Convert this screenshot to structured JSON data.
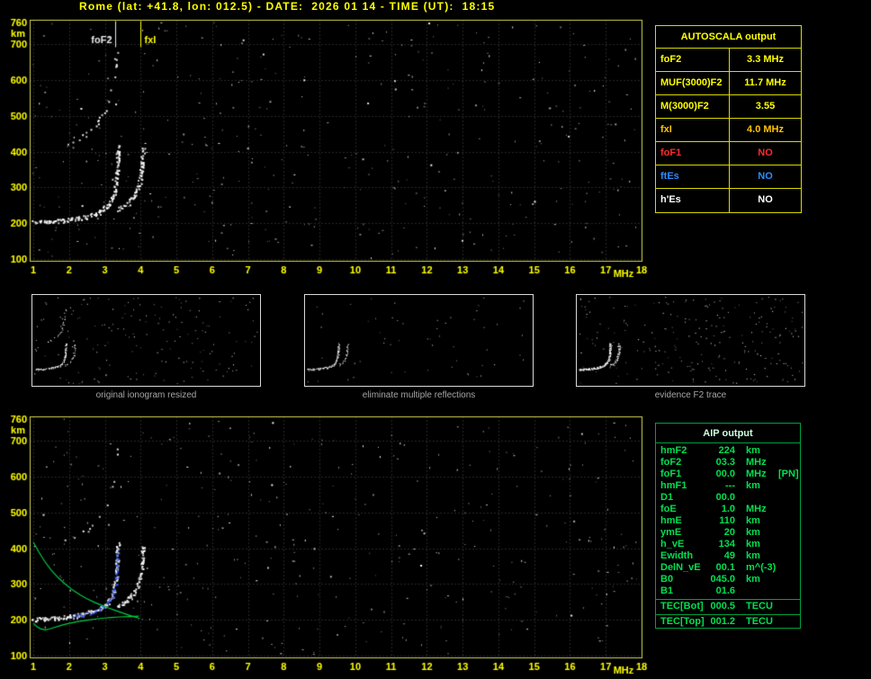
{
  "title": "Rome (lat: +41.8, lon: 012.5) - DATE:  2026 01 14 - TIME (UT):  18:15",
  "colors": {
    "background": "#000000",
    "title": "#ffff00",
    "axis_labels": "#ffff00",
    "grid": "#4f4f4f",
    "plot_border": "#d6d64e",
    "trace_white": "#ffffff",
    "autoscaled_trace_blue": "#2f55ee",
    "profile_green": "#00cc44",
    "autoscala_border": "#d8d800",
    "aip_border": "#00a040",
    "aip_text": "#00e050",
    "caption_gray": "#a6a6a6"
  },
  "autoscala_table": {
    "header": "AUTOSCALA output",
    "rows": [
      {
        "label": "foF2",
        "value": "3.3 MHz",
        "color": "#ffff00"
      },
      {
        "label": "MUF(3000)F2",
        "value": "11.7 MHz",
        "color": "#ffff00"
      },
      {
        "label": "M(3000)F2",
        "value": "3.55",
        "color": "#ffff00"
      },
      {
        "label": "fxI",
        "value": "4.0 MHz",
        "color": "#ffc400"
      },
      {
        "label": "foF1",
        "value": "NO",
        "color": "#ff2a2a"
      },
      {
        "label": "ftEs",
        "value": "NO",
        "color": "#2d8cff"
      },
      {
        "label": "h'Es",
        "value": "NO",
        "color": "#ffffff"
      }
    ]
  },
  "aip_table": {
    "header": "AIP output",
    "rows": [
      {
        "name": "hmF2",
        "value": "224",
        "unit": "km",
        "note": ""
      },
      {
        "name": "foF2",
        "value": "03.3",
        "unit": "MHz",
        "note": ""
      },
      {
        "name": "foF1",
        "value": "00.0",
        "unit": "MHz",
        "note": "[PN]"
      },
      {
        "name": "hmF1",
        "value": "---",
        "unit": "km",
        "note": ""
      },
      {
        "name": "D1",
        "value": "00.0",
        "unit": "",
        "note": ""
      },
      {
        "name": "foE",
        "value": "1.0",
        "unit": "MHz",
        "note": ""
      },
      {
        "name": "hmE",
        "value": "110",
        "unit": "km",
        "note": ""
      },
      {
        "name": "ymE",
        "value": "20",
        "unit": "km",
        "note": ""
      },
      {
        "name": "h_vE",
        "value": "134",
        "unit": "km",
        "note": ""
      },
      {
        "name": "Ewidth",
        "value": "49",
        "unit": "km",
        "note": ""
      },
      {
        "name": "DelN_vE",
        "value": "00.1",
        "unit": "m^(-3)",
        "note": ""
      },
      {
        "name": "B0",
        "value": "045.0",
        "unit": "km",
        "note": ""
      },
      {
        "name": "B1",
        "value": "01.6",
        "unit": "",
        "note": ""
      }
    ],
    "tec_rows": [
      {
        "name": "TEC[Bot]",
        "value": "000.5",
        "unit": "TECU",
        "note": ""
      },
      {
        "name": "TEC[Top]",
        "value": "001.2",
        "unit": "TECU",
        "note": ""
      }
    ]
  },
  "thumbnails": [
    {
      "caption": "original ionogram resized",
      "noise": {
        "seed": 901,
        "count": 175
      },
      "dot_traces": [
        {
          "ref": "f2_ordinary",
          "color": "#ffffff",
          "thick": 2,
          "prob": 0.9
        },
        {
          "ref": "f2_extraordinary",
          "color": "#ffffff",
          "thick": 1,
          "prob": 0.8
        },
        {
          "ref": "second_hop",
          "color": "#ffffff",
          "thick": 1,
          "prob": 0.5
        }
      ]
    },
    {
      "caption": "eliminate multiple reflections",
      "noise": {
        "seed": 902,
        "count": 55
      },
      "dot_traces": [
        {
          "ref": "f2_ordinary",
          "color": "#ffffff",
          "thick": 2,
          "prob": 0.9
        },
        {
          "ref": "f2_extraordinary",
          "color": "#ffffff",
          "thick": 1,
          "prob": 0.8
        }
      ]
    },
    {
      "caption": "evidence F2 trace",
      "noise": {
        "seed": 903,
        "count": 240
      },
      "dot_traces": [
        {
          "ref": "f2_ordinary",
          "color": "#ffffff",
          "thick": 3,
          "prob": 1
        },
        {
          "ref": "f2_extraordinary",
          "color": "#ffffff",
          "thick": 2,
          "prob": 0.9
        }
      ]
    }
  ],
  "traces": {
    "f2_ordinary": [
      [
        1.0,
        203
      ],
      [
        1.2,
        203
      ],
      [
        1.45,
        204
      ],
      [
        1.7,
        206
      ],
      [
        1.95,
        209
      ],
      [
        2.2,
        213
      ],
      [
        2.45,
        218
      ],
      [
        2.65,
        224
      ],
      [
        2.85,
        232
      ],
      [
        3.0,
        243
      ],
      [
        3.1,
        255
      ],
      [
        3.18,
        268
      ],
      [
        3.24,
        283
      ],
      [
        3.28,
        300
      ],
      [
        3.31,
        322
      ],
      [
        3.33,
        348
      ],
      [
        3.34,
        376
      ],
      [
        3.35,
        405
      ],
      [
        3.36,
        418
      ]
    ],
    "f2_extraordinary": [
      [
        3.38,
        240
      ],
      [
        3.5,
        247
      ],
      [
        3.62,
        255
      ],
      [
        3.72,
        264
      ],
      [
        3.82,
        277
      ],
      [
        3.9,
        294
      ],
      [
        3.96,
        315
      ],
      [
        4.0,
        340
      ],
      [
        4.03,
        368
      ],
      [
        4.05,
        395
      ],
      [
        4.06,
        412
      ]
    ],
    "second_hop": [
      [
        1.9,
        424
      ],
      [
        2.1,
        431
      ],
      [
        2.3,
        441
      ],
      [
        2.5,
        454
      ],
      [
        2.7,
        471
      ],
      [
        2.87,
        492
      ],
      [
        3.0,
        516
      ],
      [
        3.12,
        546
      ],
      [
        3.2,
        580
      ],
      [
        3.26,
        617
      ],
      [
        3.3,
        655
      ],
      [
        3.33,
        690
      ]
    ],
    "autoscaled_blue": [
      [
        2.1,
        211
      ],
      [
        2.3,
        214
      ],
      [
        2.5,
        218
      ],
      [
        2.7,
        224
      ],
      [
        2.88,
        232
      ],
      [
        3.02,
        243
      ],
      [
        3.12,
        255
      ],
      [
        3.2,
        269
      ],
      [
        3.26,
        286
      ],
      [
        3.3,
        306
      ],
      [
        3.32,
        330
      ],
      [
        3.34,
        358
      ],
      [
        3.35,
        385
      ],
      [
        3.36,
        402
      ]
    ],
    "profile_green": [
      [
        1.0,
        417
      ],
      [
        1.15,
        390
      ],
      [
        1.32,
        363
      ],
      [
        1.5,
        339
      ],
      [
        1.7,
        317
      ],
      [
        1.9,
        299
      ],
      [
        2.1,
        283
      ],
      [
        2.3,
        270
      ],
      [
        2.5,
        259
      ],
      [
        2.7,
        249
      ],
      [
        2.9,
        241
      ],
      [
        3.1,
        233
      ],
      [
        3.3,
        226
      ],
      [
        3.5,
        219
      ],
      [
        3.7,
        212
      ],
      [
        3.9,
        206
      ],
      [
        3.97,
        203
      ]
    ],
    "valley_green": [
      [
        1.0,
        190
      ],
      [
        1.1,
        181
      ],
      [
        1.2,
        175
      ],
      [
        1.32,
        172
      ],
      [
        1.45,
        174
      ],
      [
        1.6,
        179
      ],
      [
        1.8,
        185
      ],
      [
        2.0,
        190
      ],
      [
        2.25,
        195
      ],
      [
        2.5,
        199
      ],
      [
        2.8,
        203
      ],
      [
        3.1,
        206
      ],
      [
        3.4,
        208
      ],
      [
        3.7,
        209
      ],
      [
        3.95,
        210
      ]
    ]
  },
  "chart_data": [
    {
      "id": "top_ionogram",
      "type": "scatter",
      "title": "",
      "xlabel": "MHz",
      "ylabel": "km",
      "xlim": [
        1,
        18
      ],
      "ylim": [
        100,
        768
      ],
      "grid": true,
      "xticks": [
        1,
        2,
        3,
        4,
        5,
        6,
        7,
        8,
        9,
        10,
        11,
        12,
        13,
        14,
        15,
        16,
        17,
        18
      ],
      "yticks": [
        760,
        700,
        600,
        500,
        400,
        300,
        200,
        100
      ],
      "markers": [
        {
          "name": "foF2",
          "freq_mhz": 3.3,
          "color": "#e8e8e8",
          "side": "left"
        },
        {
          "name": "fxI",
          "freq_mhz": 4.0,
          "color": "#ffff00",
          "side": "right"
        }
      ],
      "noise": {
        "seed": 12345,
        "count": 400
      },
      "dot_traces": [
        {
          "ref": "f2_ordinary",
          "color": "#ffffff",
          "thick": 2,
          "prob": 0.95
        },
        {
          "ref": "f2_extraordinary",
          "color": "#ffffff",
          "thick": 2,
          "prob": 0.85
        },
        {
          "ref": "second_hop",
          "color": "#ffffff",
          "thick": 1,
          "prob": 0.35
        }
      ],
      "line_traces": []
    },
    {
      "id": "bottom_ionogram",
      "type": "scatter",
      "title": "",
      "xlabel": "MHz",
      "ylabel": "km",
      "xlim": [
        1,
        18
      ],
      "ylim": [
        100,
        768
      ],
      "grid": true,
      "xticks": [
        1,
        2,
        3,
        4,
        5,
        6,
        7,
        8,
        9,
        10,
        11,
        12,
        13,
        14,
        15,
        16,
        17,
        18
      ],
      "yticks": [
        760,
        700,
        600,
        500,
        400,
        300,
        200,
        100
      ],
      "markers": [],
      "noise": {
        "seed": 67890,
        "count": 360
      },
      "dot_traces": [
        {
          "ref": "f2_ordinary",
          "color": "#ffffff",
          "thick": 2,
          "prob": 0.95
        },
        {
          "ref": "f2_extraordinary",
          "color": "#ffffff",
          "thick": 2,
          "prob": 0.85
        },
        {
          "ref": "second_hop",
          "color": "#ffffff",
          "thick": 1,
          "prob": 0.3
        },
        {
          "ref": "autoscaled_blue",
          "color": "#2f55ee",
          "thick": 1,
          "prob": 1
        }
      ],
      "line_traces": [
        {
          "ref": "profile_green",
          "color": "#00cc44"
        },
        {
          "ref": "valley_green",
          "color": "#00cc44"
        }
      ]
    }
  ]
}
